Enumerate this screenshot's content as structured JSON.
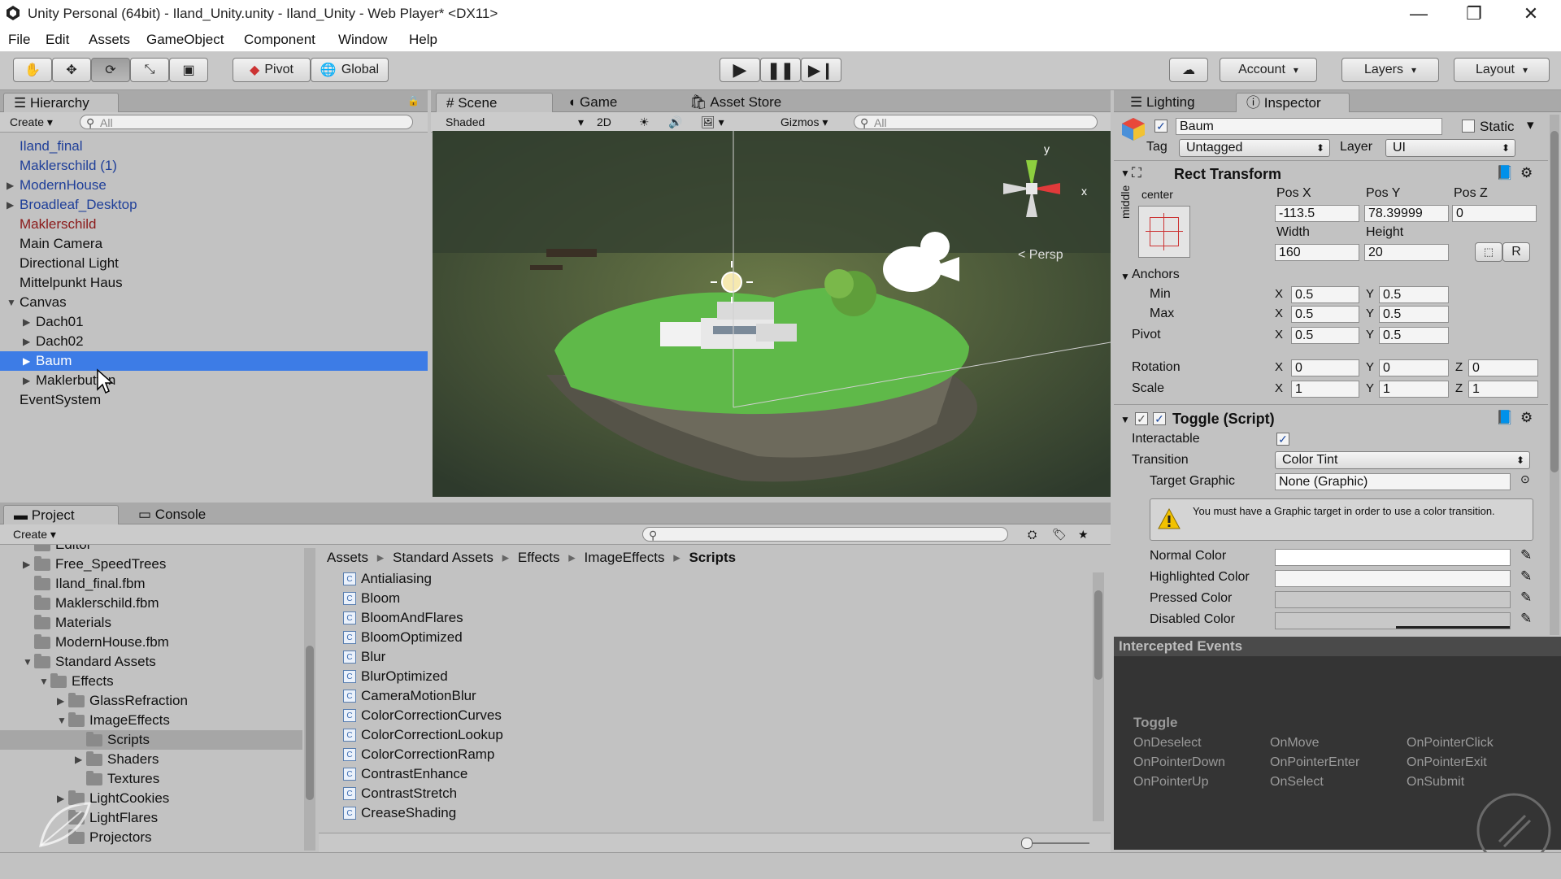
{
  "window": {
    "title": "Unity Personal (64bit) - Iland_Unity.unity - Iland_Unity - Web Player* <DX11>",
    "minimize": "—",
    "maximize": "❐",
    "close": "✕"
  },
  "menu": [
    "File",
    "Edit",
    "Assets",
    "GameObject",
    "Component",
    "Window",
    "Help"
  ],
  "toolbar": {
    "pivot": "Pivot",
    "global": "Global",
    "account": "Account",
    "layers": "Layers",
    "layout": "Layout"
  },
  "hierarchy": {
    "tab": "Hierarchy",
    "create": "Create",
    "search_placeholder": "All",
    "items": [
      {
        "label": "Iland_final"
      },
      {
        "label": "Maklerschild (1)"
      },
      {
        "label": "ModernHouse"
      },
      {
        "label": "Broadleaf_Desktop"
      },
      {
        "label": "Maklerschild"
      },
      {
        "label": "Main Camera"
      },
      {
        "label": "Directional Light"
      },
      {
        "label": "Mittelpunkt Haus"
      },
      {
        "label": "Canvas"
      },
      {
        "label": "Dach01"
      },
      {
        "label": "Dach02"
      },
      {
        "label": "Baum"
      },
      {
        "label": "Maklerbutton"
      },
      {
        "label": "EventSystem"
      }
    ]
  },
  "scene": {
    "tabs": [
      "Scene",
      "Game",
      "Asset Store"
    ],
    "shading": "Shaded",
    "mode2d": "2D",
    "gizmos": "Gizmos",
    "search_placeholder": "All",
    "axis_y": "y",
    "axis_x": "x",
    "persp": "< Persp"
  },
  "project": {
    "tabs": [
      "Project",
      "Console"
    ],
    "create": "Create",
    "tree": [
      {
        "label": "Editor"
      },
      {
        "label": "Free_SpeedTrees"
      },
      {
        "label": "Iland_final.fbm"
      },
      {
        "label": "Maklerschild.fbm"
      },
      {
        "label": "Materials"
      },
      {
        "label": "ModernHouse.fbm"
      },
      {
        "label": "Standard Assets"
      },
      {
        "label": "Effects"
      },
      {
        "label": "GlassRefraction"
      },
      {
        "label": "ImageEffects"
      },
      {
        "label": "Scripts"
      },
      {
        "label": "Shaders"
      },
      {
        "label": "Textures"
      },
      {
        "label": "LightCookies"
      },
      {
        "label": "LightFlares"
      },
      {
        "label": "Projectors"
      }
    ],
    "breadcrumb": [
      "Assets",
      "Standard Assets",
      "Effects",
      "ImageEffects",
      "Scripts"
    ],
    "scripts": [
      "Antialiasing",
      "Bloom",
      "BloomAndFlares",
      "BloomOptimized",
      "Blur",
      "BlurOptimized",
      "CameraMotionBlur",
      "ColorCorrectionCurves",
      "ColorCorrectionLookup",
      "ColorCorrectionRamp",
      "ContrastEnhance",
      "ContrastStretch",
      "CreaseShading"
    ]
  },
  "inspector": {
    "tabs": [
      "Lighting",
      "Inspector"
    ],
    "object_name": "Baum",
    "static_label": "Static",
    "tag_label": "Tag",
    "tag_value": "Untagged",
    "layer_label": "Layer",
    "layer_value": "UI",
    "rect_transform": {
      "title": "Rect Transform",
      "anchor_h": "center",
      "anchor_v": "middle",
      "posx_label": "Pos X",
      "posy_label": "Pos Y",
      "posz_label": "Pos Z",
      "posx": "-113.5",
      "posy": "78.39999",
      "posz": "0",
      "width_label": "Width",
      "height_label": "Height",
      "width": "160",
      "height": "20",
      "r_button": "R",
      "anchors_label": "Anchors",
      "min_label": "Min",
      "max_label": "Max",
      "min_x": "0.5",
      "min_y": "0.5",
      "max_x": "0.5",
      "max_y": "0.5",
      "pivot_label": "Pivot",
      "pivot_x": "0.5",
      "pivot_y": "0.5",
      "rotation_label": "Rotation",
      "rot_x": "0",
      "rot_y": "0",
      "rot_z": "0",
      "scale_label": "Scale",
      "scale_x": "1",
      "scale_y": "1",
      "scale_z": "1",
      "x": "X",
      "y": "Y",
      "z": "Z"
    },
    "toggle": {
      "title": "Toggle (Script)",
      "interactable_label": "Interactable",
      "transition_label": "Transition",
      "transition_value": "Color Tint",
      "target_graphic_label": "Target Graphic",
      "target_graphic_value": "None (Graphic)",
      "warning": "You must have a Graphic target in order to use a color transition.",
      "normal_color_label": "Normal Color",
      "highlighted_color_label": "Highlighted Color",
      "pressed_color_label": "Pressed Color",
      "disabled_color_label": "Disabled Color"
    },
    "intercepted": {
      "title": "Intercepted Events",
      "group": "Toggle",
      "events": [
        [
          "OnDeselect",
          "OnMove",
          "OnPointerClick"
        ],
        [
          "OnPointerDown",
          "OnPointerEnter",
          "OnPointerExit"
        ],
        [
          "OnPointerUp",
          "OnSelect",
          "OnSubmit"
        ]
      ]
    }
  },
  "colors": {
    "selection": "#3d7ce6",
    "prefab_blue": "#1f3f99",
    "missing_red": "#8b1a1a",
    "panel": "#c2c2c2"
  }
}
